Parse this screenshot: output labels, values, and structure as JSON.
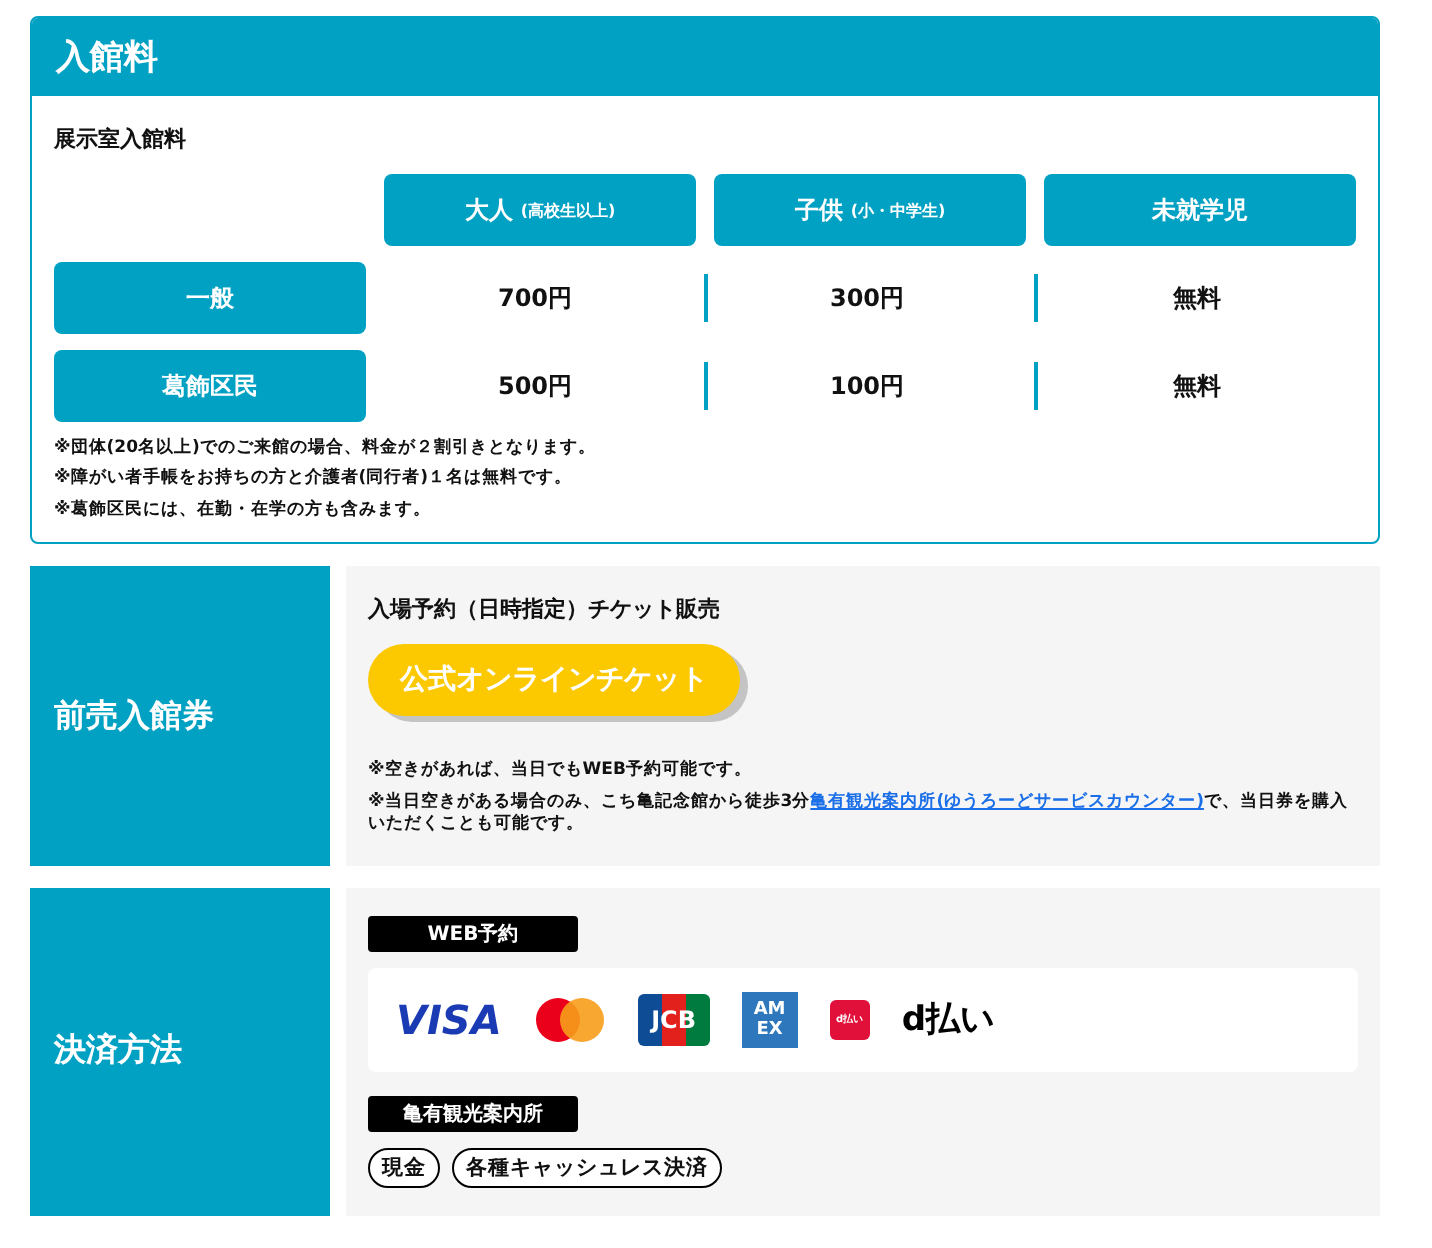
{
  "admission": {
    "title": "入館料",
    "subtitle": "展示室入館料",
    "columns": [
      {
        "label": "大人",
        "sub": "(高校生以上)"
      },
      {
        "label": "子供",
        "sub": "(小・中学生)"
      },
      {
        "label": "未就学児"
      }
    ],
    "rows": [
      {
        "label": "一般",
        "values": [
          "700円",
          "300円",
          "無料"
        ]
      },
      {
        "label": "葛飾区民",
        "values": [
          "500円",
          "100円",
          "無料"
        ]
      }
    ],
    "notes": [
      "※団体(20名以上)でのご来館の場合、料金が２割引きとなります。",
      "※障がい者手帳をお持ちの方と介護者(同行者)１名は無料です。",
      "※葛飾区民には、在勤・在学の方も含みます。"
    ]
  },
  "advance": {
    "title": "前売入館券",
    "heading": "入場予約（日時指定）チケット販売",
    "button": "公式オンラインチケット",
    "notes": [
      {
        "before": "※空きがあれば、当日でもWEB予約可能です。"
      },
      {
        "before": "※当日空きがある場合のみ、こち亀記念館から徒歩3分",
        "link": "亀有観光案内所(ゆうろーどサービスカウンター)",
        "after": "で、当日券を購入いただくことも可能です。"
      }
    ]
  },
  "payment": {
    "title": "決済方法",
    "web_label": "WEB予約",
    "logos": [
      {
        "kind": "visa",
        "label": "VISA"
      },
      {
        "kind": "mastercard"
      },
      {
        "kind": "jcb",
        "label": "JCB"
      },
      {
        "kind": "amex",
        "lines": [
          "AM",
          "EX"
        ]
      },
      {
        "kind": "dpay",
        "icon_label": "d払い",
        "label": "d払い"
      }
    ],
    "office_label": "亀有観光案内所",
    "tags": [
      "現金",
      "各種キャッシュレス決済"
    ]
  }
}
